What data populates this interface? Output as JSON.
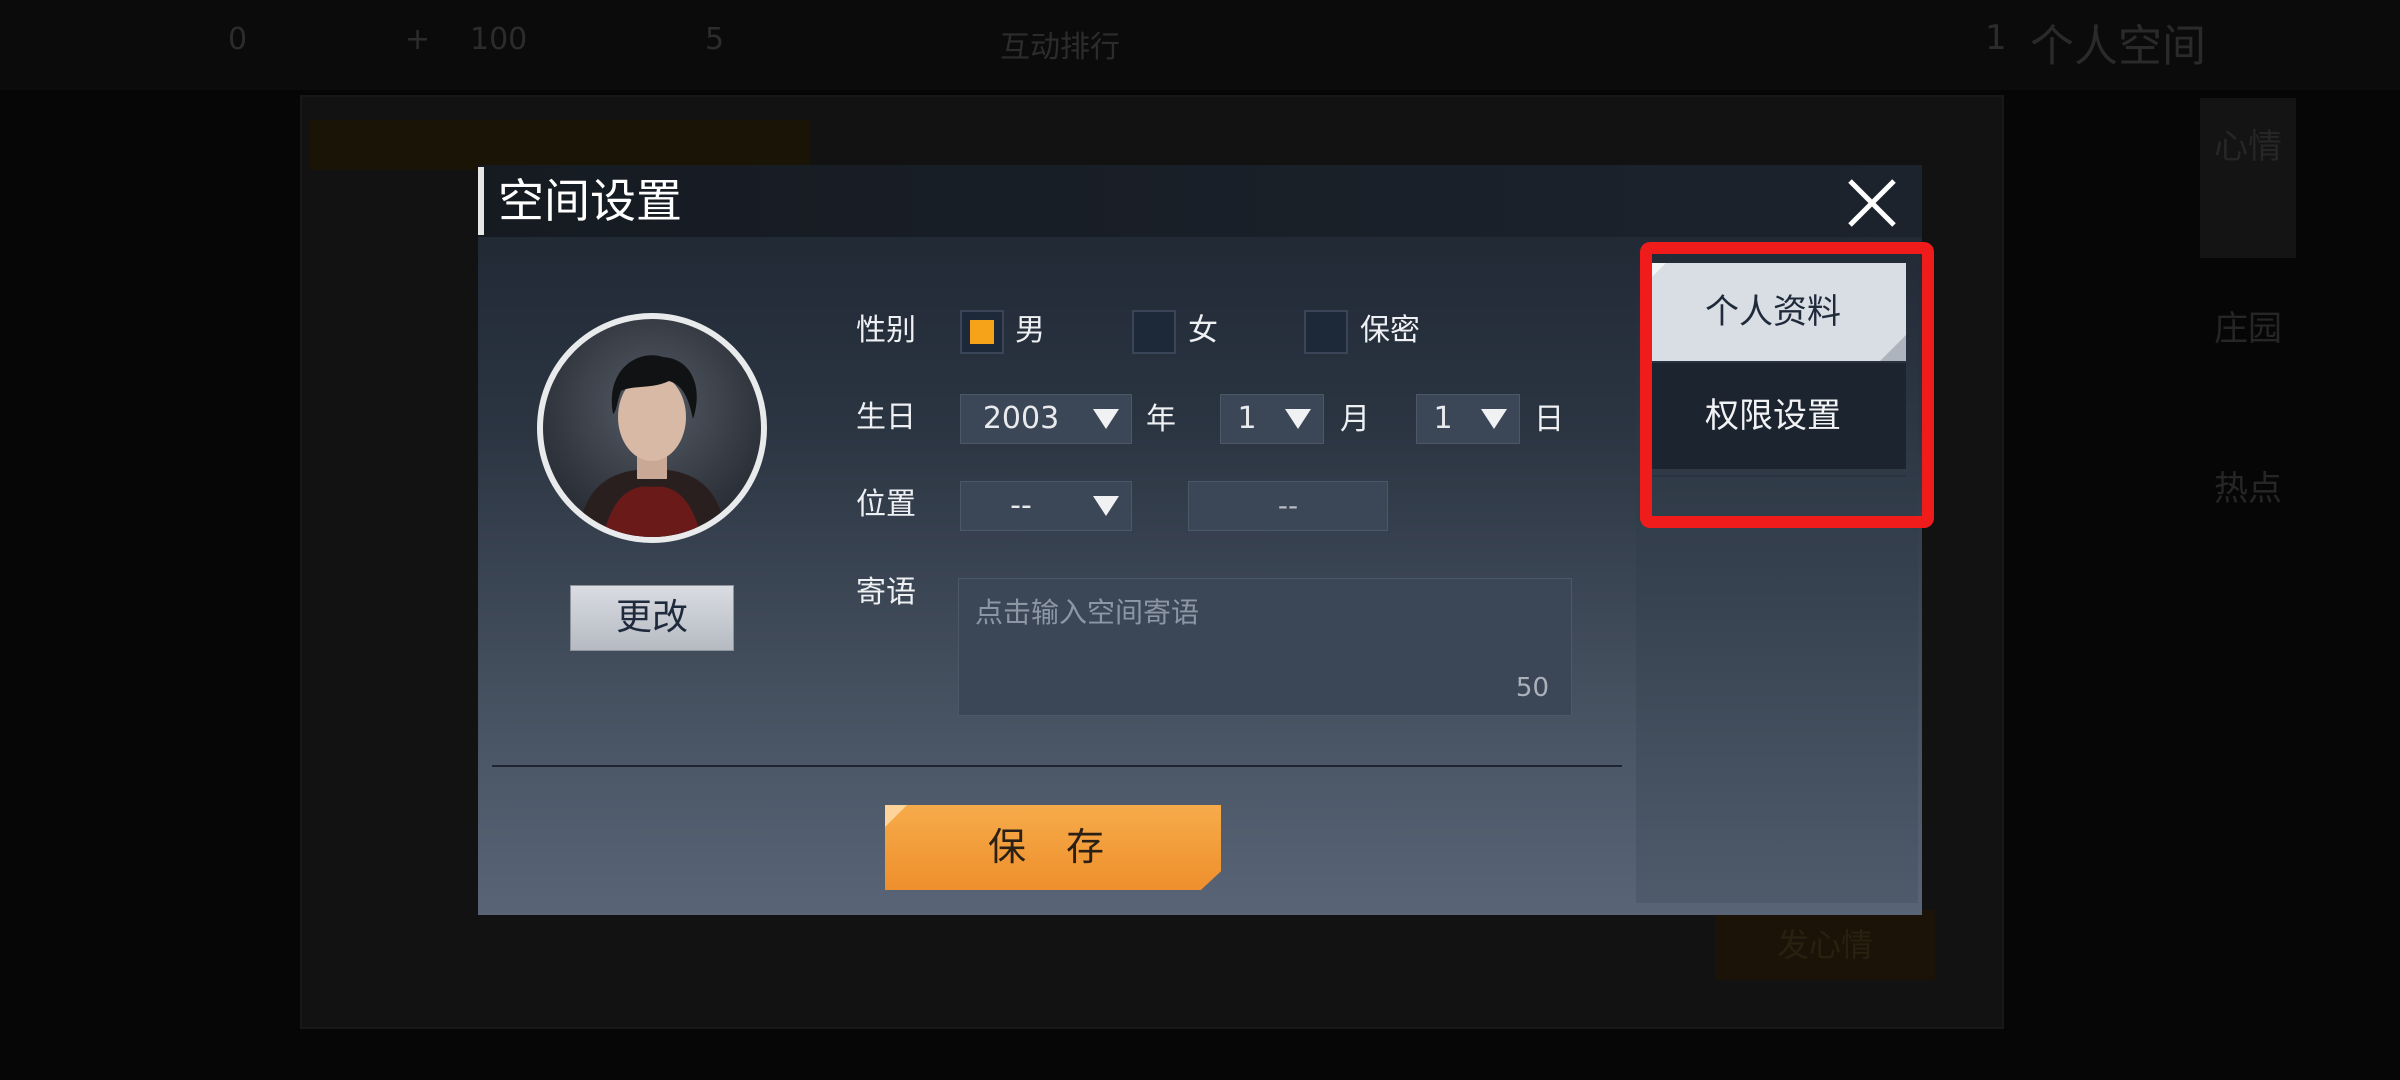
{
  "background": {
    "topbar": {
      "coins": "0",
      "crown": "100",
      "fire": "5",
      "ranking_label": "互动排行",
      "page_count": "1",
      "page_title": "个人空间"
    },
    "side_tabs": [
      "心情",
      "庄园",
      "热点"
    ],
    "post_button": "发心情"
  },
  "dialog": {
    "title": "空间设置",
    "change_button": "更改",
    "gender": {
      "label": "性别",
      "options": [
        {
          "label": "男",
          "checked": true
        },
        {
          "label": "女",
          "checked": false
        },
        {
          "label": "保密",
          "checked": false
        }
      ]
    },
    "birthday": {
      "label": "生日",
      "year": "2003",
      "year_unit": "年",
      "month": "1",
      "month_unit": "月",
      "day": "1",
      "day_unit": "日"
    },
    "location": {
      "label": "位置",
      "province": "--",
      "city": "--"
    },
    "message": {
      "label": "寄语",
      "placeholder": "点击输入空间寄语",
      "counter": "50"
    },
    "save_button": "保 存",
    "tabs": [
      "个人资料",
      "权限设置"
    ],
    "active_tab": "个人资料"
  },
  "colors": {
    "accent": "#f6a31a",
    "save": "#f29a36",
    "highlight": "#f01b1b"
  }
}
